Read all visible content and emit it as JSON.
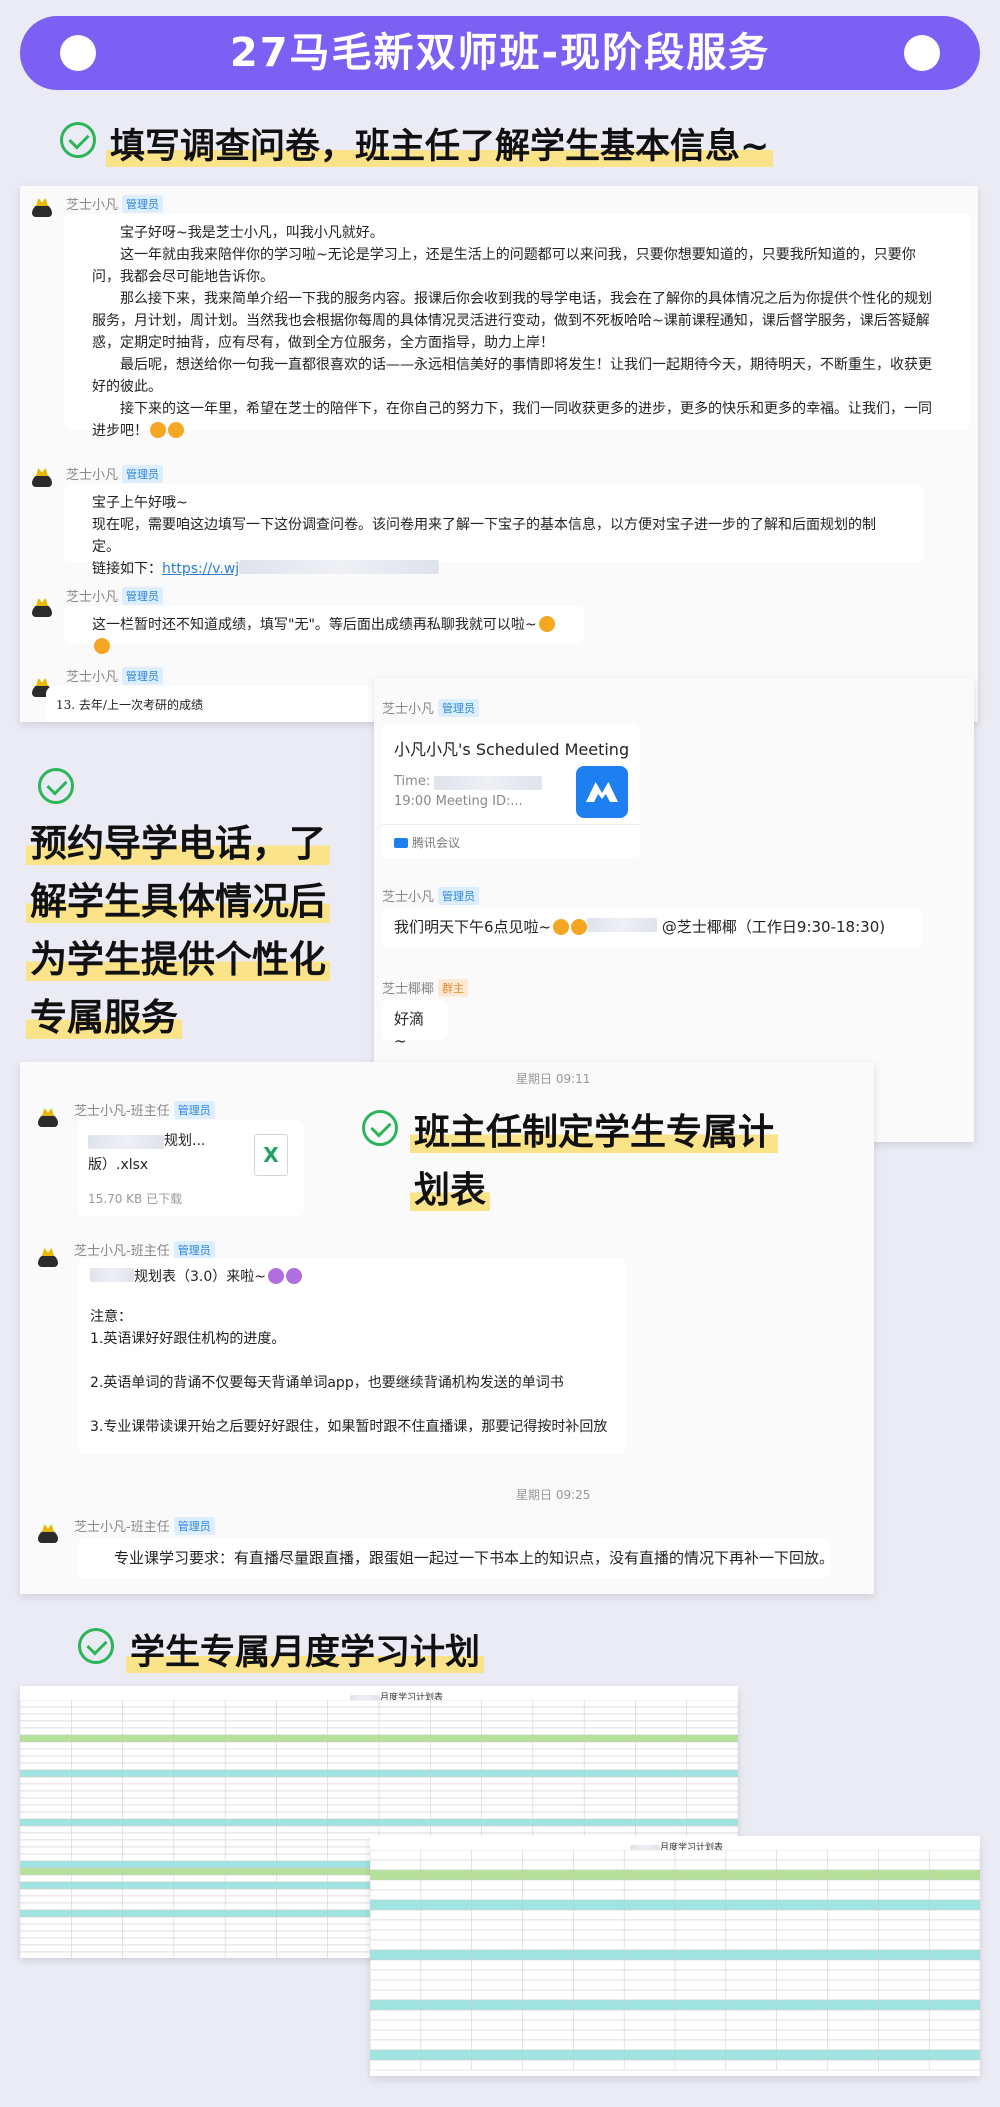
{
  "banner": {
    "title": "27马毛新双师班-现阶段服务"
  },
  "section1": {
    "heading": "填写调查问卷，班主任了解学生基本信息~"
  },
  "chat1": {
    "sender": "芝士小凡",
    "role": "管理员",
    "welcome": [
      "宝子好呀~我是芝士小凡，叫我小凡就好。",
      "这一年就由我来陪伴你的学习啦~无论是学习上，还是生活上的问题都可以来问我，只要你想要知道的，只要我所知道的，只要你问，我都会尽可能地告诉你。",
      "那么接下来，我来简单介绍一下我的服务内容。报课后你会收到我的导学电话，我会在了解你的具体情况之后为你提供个性化的规划服务，月计划，周计划。当然我也会根据你每周的具体情况灵活进行变动，做到不死板哈哈~课前课程通知，课后督学服务，课后答疑解惑，定期定时抽背，应有尽有，做到全方位服务，全方面指导，助力上岸！",
      "最后呢，想送给你一句我一直都很喜欢的话——永远相信美好的事情即将发生！让我们一起期待今天，期待明天，不断重生，收获更好的彼此。",
      "接下来的这一年里，希望在芝士的陪伴下，在你自己的努力下，我们一同收获更多的进步，更多的快乐和更多的幸福。让我们，一同进步吧！"
    ],
    "survey_greeting": "宝子上午好哦~",
    "survey_text": "现在呢，需要咱这边填写一下这份调查问卷。该问卷用来了解一下宝子的基本信息，以方便对宝子进一步的了解和后面规划的制定。",
    "survey_link_label": "链接如下：",
    "survey_link": "https://v.wj",
    "score_note": "这一栏暂时还不知道成绩，填写\"无\"。等后面出成绩再私聊我就可以啦~",
    "question_preview": "13. 去年/上一次考研的成绩"
  },
  "section2": {
    "lines": [
      "预约导学电话，了",
      "解学生具体情况后",
      "为学生提供个性化",
      "专属服务"
    ]
  },
  "chat2": {
    "sender": "芝士小凡",
    "role": "管理员",
    "meeting_title": "小凡小凡's Scheduled Meeting",
    "meeting_time_label": "Time:",
    "meeting_time_detail": "19:00 Meeting ID:...",
    "meeting_app": "腾讯会议",
    "reminder_prefix": "我们明天下午6点见啦~",
    "reminder_mention": "@芝士椰椰（工作日9:30-18:30)",
    "reply_sender": "芝士椰椰",
    "reply_role": "群主",
    "reply_text": "好滴~"
  },
  "section3": {
    "lines": [
      "班主任制定学生专属计",
      "划表"
    ]
  },
  "chat3": {
    "timestamp1": "星期日 09:11",
    "sender": "芝士小凡-班主任",
    "role": "管理员",
    "file_name_line1": "规划...",
    "file_name_line2": "版）.xlsx",
    "file_size": "15.70 KB",
    "file_status": "已下载",
    "plan_title": "规划表（3.0）来啦~",
    "notice_label": "注意：",
    "notes": [
      "1.英语课好好跟住机构的进度。",
      "2.英语单词的背诵不仅要每天背诵单词app，也要继续背诵机构发送的单词书",
      "3.专业课带读课开始之后要好好跟住，如果暂时跟不住直播课，那要记得按时补回放"
    ],
    "timestamp2": "星期日 09:25",
    "requirement": "专业课学习要求：有直播尽量跟直播，跟蛋姐一起过一下书本上的知识点，没有直播的情况下再补一下回放。"
  },
  "section4": {
    "heading": "学生专属月度学习计划"
  },
  "sheets": {
    "title": "月度学习计划表"
  },
  "colors": {
    "banner": "#7c5ff3",
    "check": "#2bb558",
    "highlight": "#fbe38a",
    "link": "#2f7fd0",
    "sheet_green": "#b6e19a",
    "sheet_teal": "#9fe4e0"
  },
  "icons": [
    "check-icon",
    "avatar-icon",
    "tencent-meeting-icon",
    "excel-file-icon",
    "emoji-icon"
  ]
}
